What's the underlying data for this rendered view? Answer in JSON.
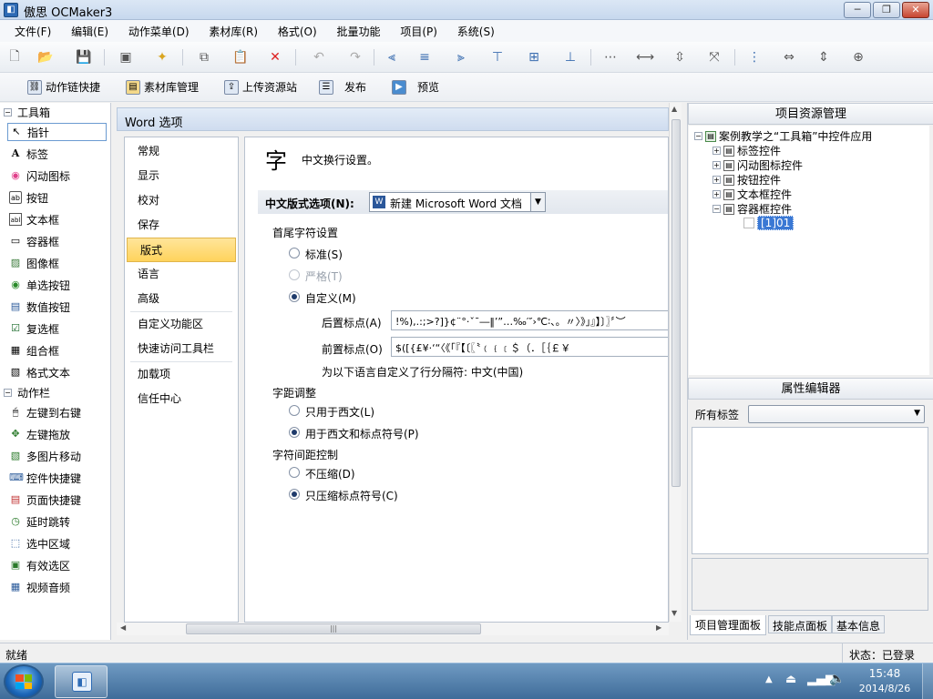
{
  "window": {
    "title": "傲思 OCMaker3",
    "controls": {
      "min": "─",
      "max": "❐",
      "close": "✕"
    }
  },
  "menu": [
    "文件(F)",
    "编辑(E)",
    "动作菜单(D)",
    "素材库(R)",
    "格式(O)",
    "批量功能",
    "项目(P)",
    "系统(S)"
  ],
  "quickbar": [
    {
      "label": "动作链快捷",
      "icon": "action-chain-icon"
    },
    {
      "label": "素材库管理",
      "icon": "library-icon"
    },
    {
      "label": "上传资源站",
      "icon": "upload-icon"
    },
    {
      "label": "发布",
      "icon": "publish-icon"
    },
    {
      "label": "预览",
      "icon": "preview-icon"
    }
  ],
  "toolbox": {
    "header": "工具箱",
    "items": [
      "指针",
      "标签",
      "闪动图标",
      "按钮",
      "文本框",
      "容器框",
      "图像框",
      "单选按钮",
      "数值按钮",
      "复选框",
      "组合框",
      "格式文本"
    ],
    "icons": [
      "↖",
      "A",
      "◉",
      "ab",
      "abl",
      "▭",
      "▨",
      "◉",
      "▤",
      "☑",
      "▦",
      "▧"
    ]
  },
  "actionbar": {
    "header": "动作栏",
    "items": [
      "左键到右键",
      "左键拖放",
      "多图片移动",
      "控件快捷键",
      "页面快捷键",
      "延时跳转",
      "选中区域",
      "有效选区",
      "视频音频"
    ]
  },
  "word_options": {
    "header": "Word 选项",
    "nav": [
      "常规",
      "显示",
      "校对",
      "保存",
      "版式",
      "语言",
      "高级",
      "自定义功能区",
      "快速访问工具栏",
      "加载项",
      "信任中心"
    ],
    "selected_nav": "版式",
    "section_icon": "字",
    "section_title": "中文换行设置。",
    "layout_option_label": "中文版式选项(N):",
    "layout_option_value": "新建 Microsoft Word 文档",
    "line_break_header": "首尾字符设置",
    "radio_standard": "标准(S)",
    "radio_strict": "严格(T)",
    "radio_custom": "自定义(M)",
    "following_label": "后置标点(A)",
    "following_value": "!%),.:;>?]}¢¨°·ˇˉ―‖’”…‰′″›℃∶、。〃〉》」』】〕〗〞︶",
    "leading_label": "前置标点(O)",
    "leading_value": "$([{£¥·‘“〈《「『【〔〖〝﹙﹛﹝＄（．［｛￡￥",
    "custom_note": "为以下语言自定义了行分隔符: 中文(中国)",
    "kerning_header": "字距调整",
    "kerning_western": "只用于西文(L)",
    "kerning_punct": "用于西文和标点符号(P)",
    "spacing_header": "字符间距控制",
    "spacing_none": "不压缩(D)",
    "spacing_punct": "只压缩标点符号(C)"
  },
  "project_manager": {
    "title": "项目资源管理",
    "root": "案例教学之“工具箱”中控件应用",
    "nodes": [
      "标签控件",
      "闪动图标控件",
      "按钮控件",
      "文本框控件",
      "容器框控件"
    ],
    "leaf": "[1]01"
  },
  "property_editor": {
    "title": "属性编辑器",
    "filter_label": "所有标签"
  },
  "right_tabs": [
    "项目管理面板",
    "技能点面板",
    "基本信息"
  ],
  "status": {
    "left": "就绪",
    "right": "状态：已登录"
  },
  "taskbar": {
    "time": "15:48",
    "date": "2014/8/26"
  }
}
